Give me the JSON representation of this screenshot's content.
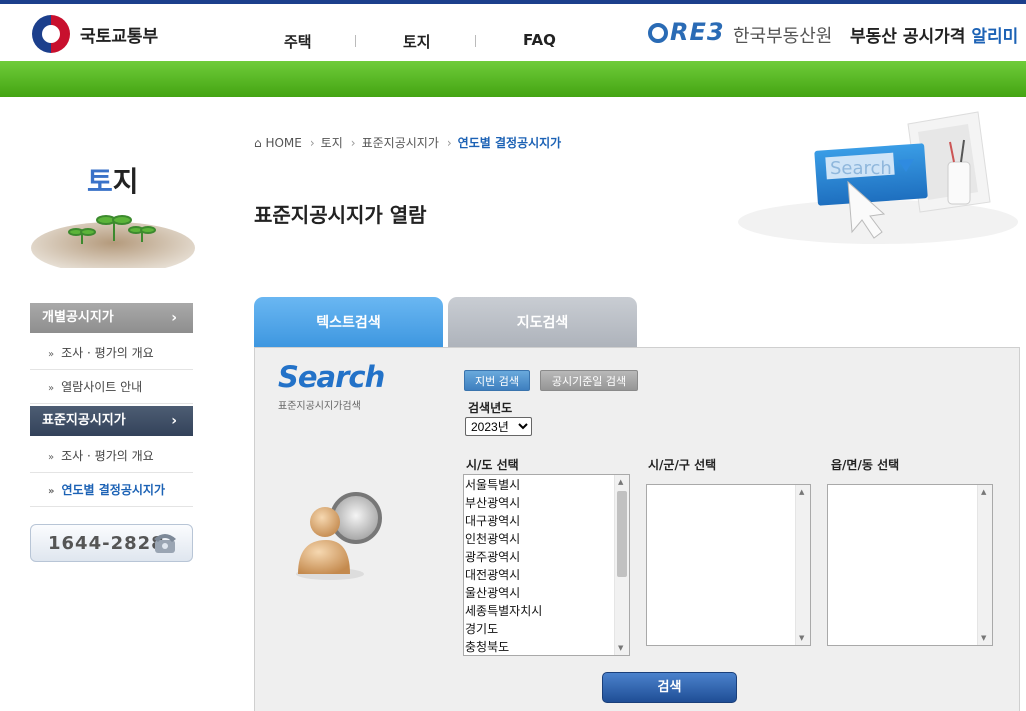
{
  "header": {
    "ministry_name": "국토교통부",
    "nav": [
      "주택",
      "토지",
      "FAQ"
    ],
    "reb_logo": "RE3",
    "reb_name": "한국부동산원",
    "service_name_prefix": "부동산 공시가격",
    "service_name_highlight": "알리미"
  },
  "sidebar": {
    "title_first": "토",
    "title_rest": "지",
    "menu": [
      {
        "label": "개별공시지가",
        "subs": [
          "조사 · 평가의 개요",
          "열람사이트 안내"
        ]
      },
      {
        "label": "표준지공시지가",
        "subs": [
          "조사 · 평가의 개요",
          "연도별 결정공시지가"
        ]
      }
    ],
    "phone": "1644-2828"
  },
  "breadcrumb": {
    "home": "HOME",
    "level1": "토지",
    "level2": "표준지공시지가",
    "current": "연도별 결정공시지가"
  },
  "page_title": "표준지공시지가 열람",
  "hero_search_text": "Search",
  "tabs": {
    "active": "텍스트검색",
    "inactive": "지도검색"
  },
  "search_panel": {
    "logo_word": "Search",
    "logo_sub": "표준지공시지가검색",
    "btn_lot": "지번 검색",
    "btn_date": "공시기준일 검색",
    "year_label": "검색년도",
    "year_value": "2023년",
    "col_sido": "시/도 선택",
    "col_sigungu": "시/군/구 선택",
    "col_eupmyeondong": "읍/면/동 선택",
    "sido_options": [
      "서울특별시",
      "부산광역시",
      "대구광역시",
      "인천광역시",
      "광주광역시",
      "대전광역시",
      "울산광역시",
      "세종특별자치시",
      "경기도",
      "충청북도"
    ],
    "search_button": "검색"
  }
}
